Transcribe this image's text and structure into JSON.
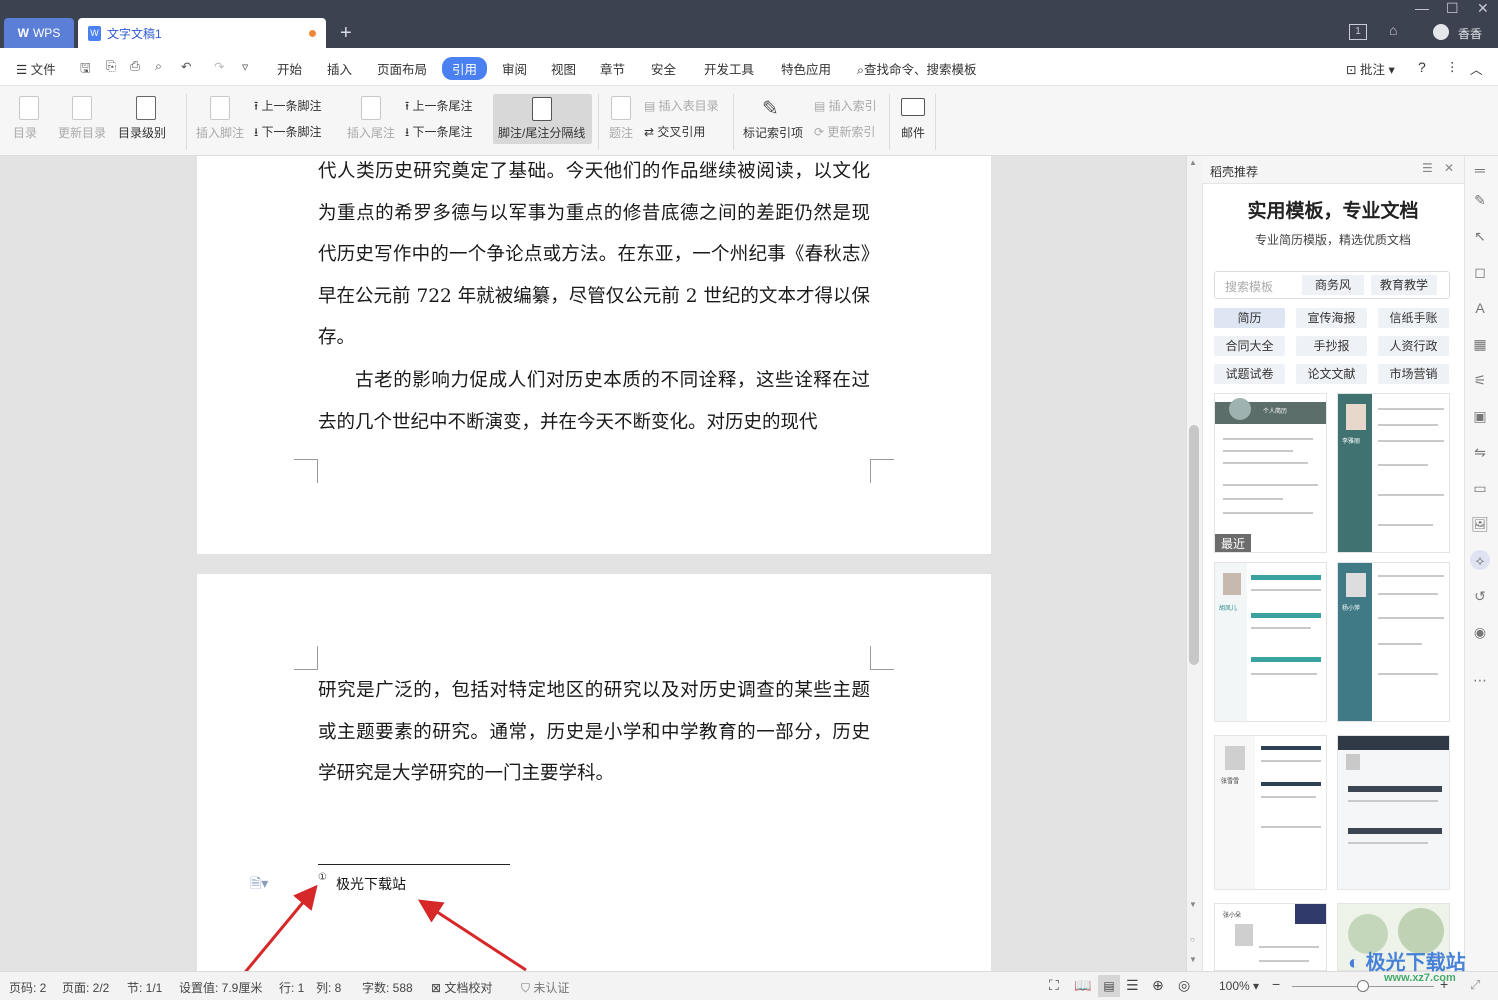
{
  "titlebar": {
    "wps_tab": "WPS",
    "doc_tab": "文字文稿1",
    "add_tab": "+",
    "user_name": "香香"
  },
  "menubar": {
    "file": "文件",
    "items": [
      "开始",
      "插入",
      "页面布局",
      "引用",
      "审阅",
      "视图",
      "章节",
      "安全",
      "开发工具",
      "特色应用"
    ],
    "search": "查找命令、搜索模板",
    "comment": "批注",
    "help": "?"
  },
  "ribbon": {
    "toc": "目录",
    "update_toc": "更新目录",
    "toc_level": "目录级别",
    "insert_footnote": "插入脚注",
    "prev_footnote": "上一条脚注",
    "next_footnote": "下一条脚注",
    "insert_endnote": "插入尾注",
    "prev_endnote": "上一条尾注",
    "next_endnote": "下一条尾注",
    "separator": "脚注/尾注分隔线",
    "caption": "题注",
    "insert_table_toc": "插入表目录",
    "cross_ref": "交叉引用",
    "mark_index": "标记索引项",
    "insert_index": "插入索引",
    "update_index": "更新索引",
    "mail": "邮件"
  },
  "document": {
    "page1_paragraphs": [
      "代人类历史研究奠定了基础。今天他们的作品继续被阅读，以文化为重点的希罗多德与以军事为重点的修昔底德之间的差距仍然是现代历史写作中的一个争论点或方法。在东亚，一个州纪事《春秋志》早在公元前 722 年就被编纂，尽管仅公元前 2 世纪的文本才得以保存。",
      "古老的影响力促成人们对历史本质的不同诠释，这些诠释在过去的几个世纪中不断演变，并在今天不断变化。对历史的现代"
    ],
    "page2_paragraph": "研究是广泛的，包括对特定地区的研究以及对历史调查的某些主题或主题要素的研究。通常，历史是小学和中学教育的一部分，历史学研究是大学研究的一门主要学科。",
    "footnote_marker": "①",
    "footnote_text": "极光下载站"
  },
  "panel": {
    "title": "稻壳推荐",
    "headline": "实用模板，专业文档",
    "subhead": "专业简历模版，精选优质文档",
    "search_placeholder": "搜索模板",
    "search_tags": [
      "商务风",
      "教育教学"
    ],
    "tags": [
      "简历",
      "宣传海报",
      "信纸手账",
      "合同大全",
      "手抄报",
      "人资行政",
      "试题试卷",
      "论文文献",
      "市场营销"
    ],
    "recent_badge": "最近",
    "card_names": [
      "个人简历",
      "李雅丽",
      "胡凤儿",
      "杨小萍",
      "张雪雪",
      "",
      "张小朵",
      ""
    ]
  },
  "statusbar": {
    "page_no": "页码: 2",
    "pages": "页面: 2/2",
    "section": "节: 1/1",
    "setting": "设置值: 7.9厘米",
    "row": "行: 1",
    "col": "列: 8",
    "words": "字数: 588",
    "proof": "文档校对",
    "auth": "未认证",
    "zoom": "100%",
    "watermark": "极光下载站",
    "watermark_url": "www.xz7.com"
  },
  "colors": {
    "accent": "#4b80f0",
    "titlebar": "#3d4250",
    "arrow": "#d62828"
  }
}
